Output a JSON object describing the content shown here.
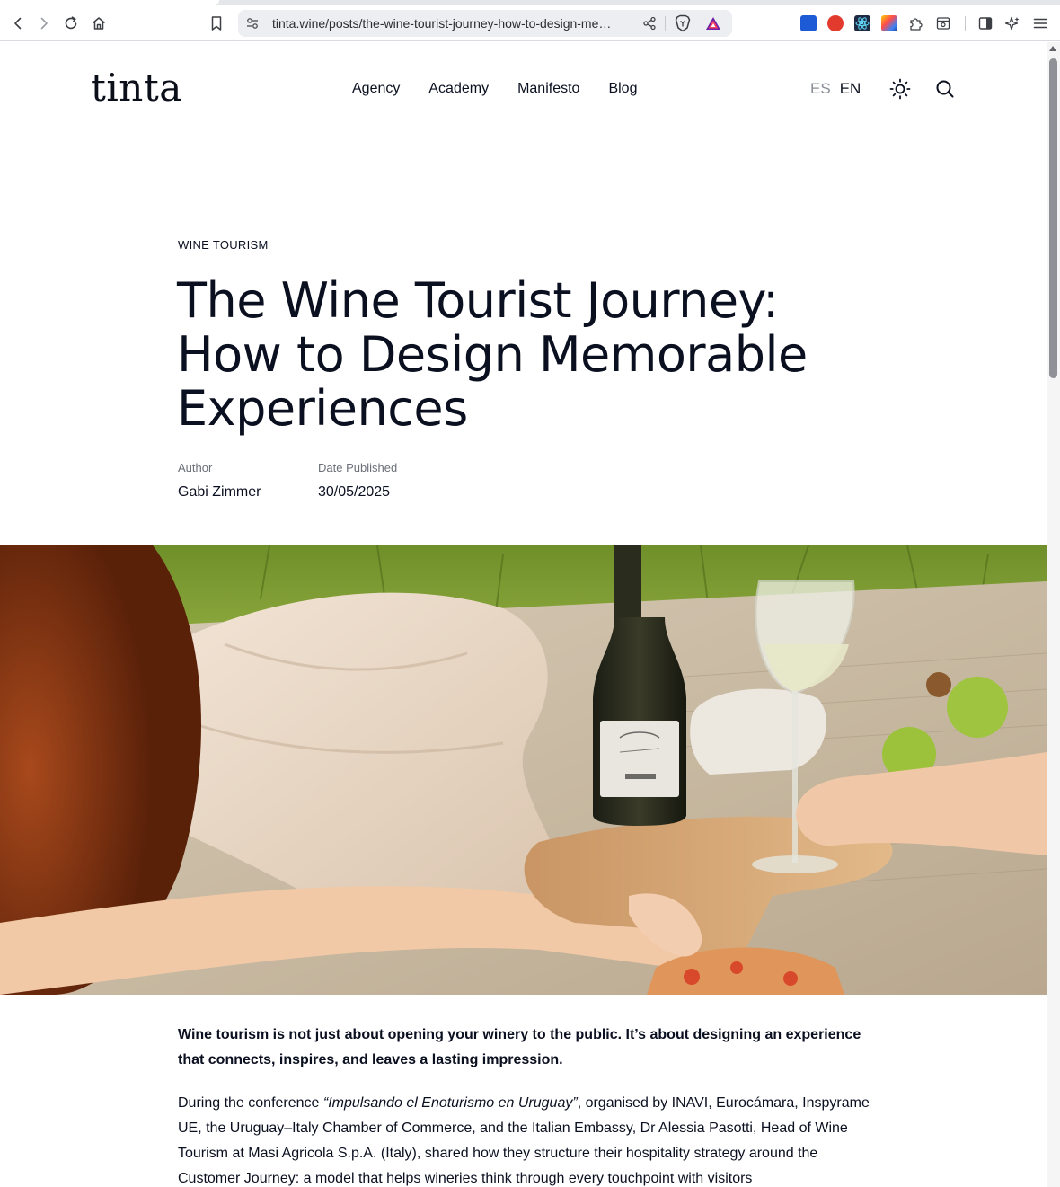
{
  "browser": {
    "url": "tinta.wine/posts/the-wine-tourist-journey-how-to-design-me…"
  },
  "site": {
    "logo": "tinta",
    "nav": [
      "Agency",
      "Academy",
      "Manifesto",
      "Blog"
    ],
    "languages": {
      "es": "ES",
      "en": "EN",
      "active": "EN"
    }
  },
  "article": {
    "category": "WINE TOURISM",
    "title_lines": [
      "The Wine Tourist Journey:",
      "How to Design Memorable",
      "Experiences"
    ],
    "author_label": "Author",
    "author": "Gabi Zimmer",
    "date_label": "Date Published",
    "date": "30/05/2025",
    "lead": "Wine tourism is not just about opening your winery to the public. It’s about designing an experience that connects, inspires, and leaves a lasting impression.",
    "para_before": "During the conference ",
    "para_em": "“Impulsando el Enoturismo en Uruguay”",
    "para_after": ", organised by INAVI, Eurocámara, Inspyrame UE, the Uruguay–Italy Chamber of Commerce, and the Italian Embassy, Dr Alessia Pasotti, Head of Wine Tourism at Masi Agricola S.p.A. (Italy), shared how they structure their hospitality strategy around the Customer Journey: a model that helps wineries think through every touchpoint with visitors"
  },
  "colors": {
    "text": "#0b1020",
    "muted": "#6a6f78",
    "language_inactive": "#8a8e96"
  },
  "icons": [
    "back-icon",
    "forward-icon",
    "reload-icon",
    "home-icon",
    "bookmark-icon",
    "site-settings-icon",
    "share-icon",
    "brave-shields-icon",
    "brave-rewards-icon",
    "extensions-icon",
    "sidebar-icon",
    "leo-icon",
    "menu-icon",
    "sun-icon",
    "search-icon"
  ]
}
